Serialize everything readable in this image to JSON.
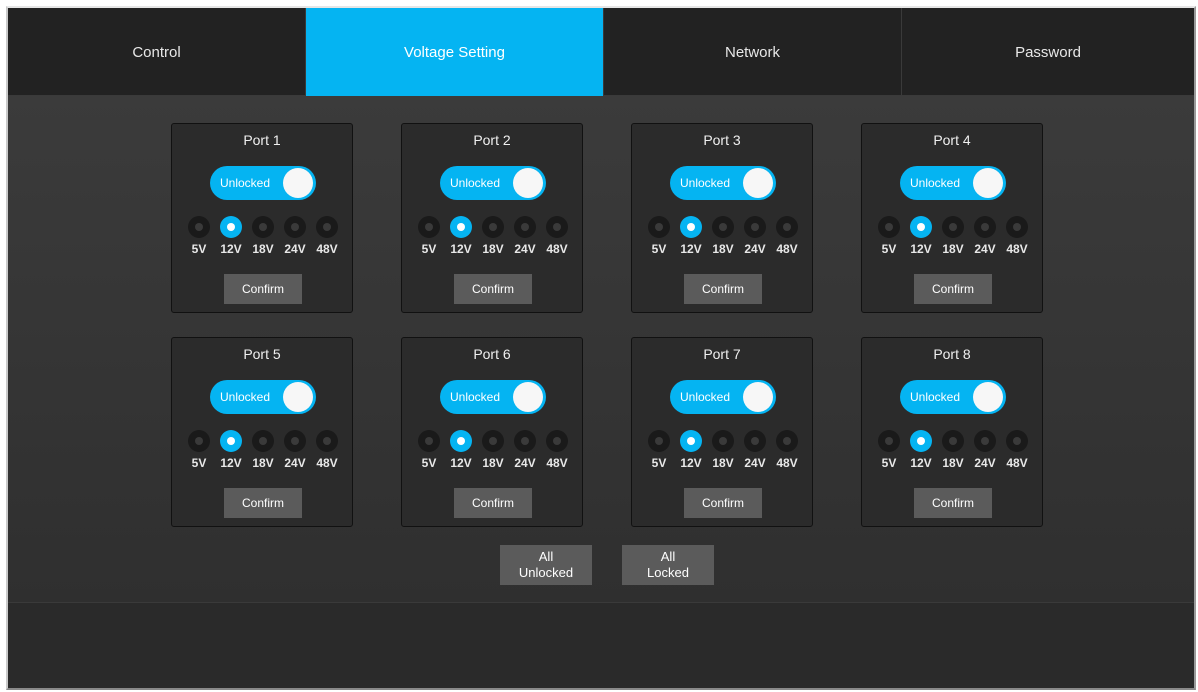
{
  "tabs": [
    {
      "label": "Control",
      "active": false
    },
    {
      "label": "Voltage Setting",
      "active": true
    },
    {
      "label": "Network",
      "active": false
    },
    {
      "label": "Password",
      "active": false
    }
  ],
  "voltage_options": [
    "5V",
    "12V",
    "18V",
    "24V",
    "48V"
  ],
  "ports": [
    {
      "name": "Port 1",
      "lock_state": "Unlocked",
      "selected_voltage": "12V",
      "confirm_label": "Confirm"
    },
    {
      "name": "Port 2",
      "lock_state": "Unlocked",
      "selected_voltage": "12V",
      "confirm_label": "Confirm"
    },
    {
      "name": "Port 3",
      "lock_state": "Unlocked",
      "selected_voltage": "12V",
      "confirm_label": "Confirm"
    },
    {
      "name": "Port 4",
      "lock_state": "Unlocked",
      "selected_voltage": "12V",
      "confirm_label": "Confirm"
    },
    {
      "name": "Port 5",
      "lock_state": "Unlocked",
      "selected_voltage": "12V",
      "confirm_label": "Confirm"
    },
    {
      "name": "Port 6",
      "lock_state": "Unlocked",
      "selected_voltage": "12V",
      "confirm_label": "Confirm"
    },
    {
      "name": "Port 7",
      "lock_state": "Unlocked",
      "selected_voltage": "12V",
      "confirm_label": "Confirm"
    },
    {
      "name": "Port 8",
      "lock_state": "Unlocked",
      "selected_voltage": "12V",
      "confirm_label": "Confirm"
    }
  ],
  "bulk_actions": {
    "all_unlocked": {
      "line1": "All",
      "line2": "Unlocked"
    },
    "all_locked": {
      "line1": "All",
      "line2": "Locked"
    }
  },
  "colors": {
    "accent": "#05b4f2",
    "background": "#2c2c2c",
    "button": "#5b5b5b"
  }
}
